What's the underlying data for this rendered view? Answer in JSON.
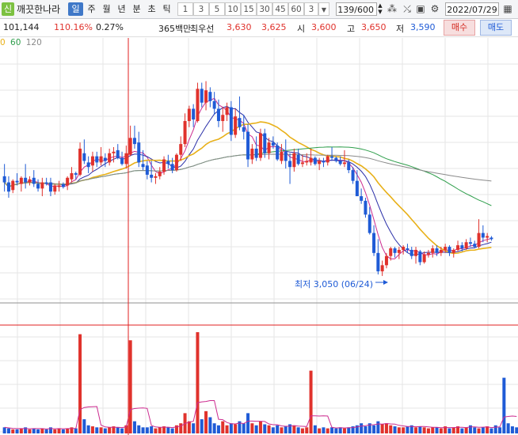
{
  "toolbar": {
    "logo": "신",
    "stock_name": "깨끗한나라",
    "periods": [
      "일",
      "주",
      "월",
      "년",
      "분",
      "초",
      "틱"
    ],
    "active_period": "일",
    "minute_options": [
      "1",
      "3",
      "5",
      "10",
      "15",
      "30",
      "45",
      "60"
    ],
    "selected_minute": "3",
    "count_value": "139/600",
    "date_value": "2022/07/29",
    "icons": [
      "chart-settings-icon",
      "draw-tool-icon",
      "save-icon",
      "gear-icon",
      "calendar-icon"
    ]
  },
  "quote": {
    "volume": "101,144",
    "ratio": "110.16%",
    "change_rate": "0.27%",
    "million_label": "365백만",
    "best_bid_label": "최우선",
    "best_ask": "3,630",
    "best_bid": "3,625",
    "open_label": "시",
    "open": "3,600",
    "high_label": "고",
    "high": "3,650",
    "low_label": "저",
    "low": "3,590",
    "buy_label": "매수",
    "sell_label": "매도"
  },
  "ma_legend": {
    "ma60": "60",
    "ma120": "120"
  },
  "low_marker": "최저 3,050 (06/24)",
  "colors": {
    "up": "#e0322c",
    "down": "#1f5bd6",
    "ma5": "#cc2b8f",
    "ma10": "#2a2fa8",
    "ma20": "#e8b018",
    "ma60": "#2e9e4b",
    "ma120": "#8a8a8a",
    "crosshair": "#e02020"
  },
  "chart_data": {
    "type": "candlestick",
    "y_min": 2900,
    "y_max": 4550,
    "candles": [
      [
        3700,
        3780,
        3600,
        3660
      ],
      [
        3660,
        3700,
        3560,
        3600
      ],
      [
        3610,
        3680,
        3590,
        3670
      ],
      [
        3670,
        3720,
        3640,
        3660
      ],
      [
        3650,
        3700,
        3600,
        3690
      ],
      [
        3690,
        3780,
        3620,
        3660
      ],
      [
        3660,
        3700,
        3640,
        3680
      ],
      [
        3690,
        3740,
        3630,
        3650
      ],
      [
        3650,
        3680,
        3600,
        3620
      ],
      [
        3620,
        3690,
        3570,
        3660
      ],
      [
        3660,
        3690,
        3640,
        3650
      ],
      [
        3660,
        3690,
        3570,
        3600
      ],
      [
        3600,
        3650,
        3580,
        3640
      ],
      [
        3630,
        3670,
        3600,
        3640
      ],
      [
        3650,
        3660,
        3620,
        3630
      ],
      [
        3640,
        3700,
        3610,
        3690
      ],
      [
        3680,
        3760,
        3660,
        3720
      ],
      [
        3720,
        3730,
        3680,
        3710
      ],
      [
        3710,
        3920,
        3700,
        3880
      ],
      [
        3850,
        3940,
        3780,
        3800
      ],
      [
        3790,
        3830,
        3720,
        3760
      ],
      [
        3770,
        3860,
        3730,
        3830
      ],
      [
        3830,
        3860,
        3760,
        3790
      ],
      [
        3790,
        3890,
        3770,
        3830
      ],
      [
        3820,
        3850,
        3760,
        3800
      ],
      [
        3790,
        3880,
        3770,
        3850
      ],
      [
        3850,
        3890,
        3790,
        3860
      ],
      [
        3870,
        3910,
        3810,
        3820
      ],
      [
        3820,
        3860,
        3770,
        3780
      ],
      [
        3780,
        3900,
        3750,
        3850
      ],
      [
        3840,
        4030,
        3830,
        3950
      ],
      [
        3950,
        4030,
        3880,
        3910
      ],
      [
        3920,
        3990,
        3760,
        3790
      ],
      [
        3780,
        3870,
        3740,
        3760
      ],
      [
        3770,
        3800,
        3680,
        3710
      ],
      [
        3710,
        3800,
        3660,
        3690
      ],
      [
        3690,
        3720,
        3650,
        3700
      ],
      [
        3700,
        3760,
        3680,
        3730
      ],
      [
        3730,
        3830,
        3710,
        3810
      ],
      [
        3800,
        3840,
        3750,
        3780
      ],
      [
        3780,
        3820,
        3720,
        3740
      ],
      [
        3740,
        3850,
        3730,
        3840
      ],
      [
        3840,
        3960,
        3800,
        3910
      ],
      [
        3910,
        4110,
        3890,
        4060
      ],
      [
        4060,
        4160,
        4020,
        4140
      ],
      [
        4140,
        4170,
        4020,
        4070
      ],
      [
        4060,
        4310,
        4050,
        4270
      ],
      [
        4270,
        4310,
        4150,
        4180
      ],
      [
        4180,
        4320,
        4130,
        4260
      ],
      [
        4250,
        4280,
        4150,
        4190
      ],
      [
        4190,
        4250,
        4100,
        4140
      ],
      [
        4140,
        4200,
        4020,
        4060
      ],
      [
        4060,
        4150,
        3990,
        4100
      ],
      [
        4100,
        4180,
        4060,
        4150
      ],
      [
        4150,
        4190,
        3930,
        3970
      ],
      [
        3970,
        4140,
        3950,
        4090
      ],
      [
        4080,
        4220,
        4000,
        4020
      ],
      [
        4020,
        4100,
        3940,
        3990
      ],
      [
        3990,
        4040,
        3760,
        3810
      ],
      [
        3810,
        3910,
        3780,
        3880
      ],
      [
        3880,
        3960,
        3800,
        3820
      ],
      [
        3820,
        4010,
        3800,
        3980
      ],
      [
        3980,
        4010,
        3820,
        3850
      ],
      [
        3850,
        3950,
        3810,
        3920
      ],
      [
        3920,
        3960,
        3880,
        3900
      ],
      [
        3900,
        3920,
        3800,
        3810
      ],
      [
        3800,
        3910,
        3780,
        3860
      ],
      [
        3860,
        3940,
        3750,
        3800
      ],
      [
        3800,
        3850,
        3650,
        3760
      ],
      [
        3760,
        3880,
        3730,
        3850
      ],
      [
        3840,
        3880,
        3770,
        3780
      ],
      [
        3780,
        3840,
        3760,
        3790
      ],
      [
        3790,
        3850,
        3770,
        3800
      ],
      [
        3790,
        3880,
        3770,
        3820
      ],
      [
        3820,
        3830,
        3770,
        3780
      ],
      [
        3780,
        3820,
        3740,
        3800
      ],
      [
        3800,
        3820,
        3760,
        3790
      ],
      [
        3790,
        3840,
        3770,
        3830
      ],
      [
        3830,
        3890,
        3800,
        3820
      ],
      [
        3820,
        3830,
        3790,
        3800
      ],
      [
        3800,
        3830,
        3770,
        3780
      ],
      [
        3780,
        3870,
        3760,
        3790
      ],
      [
        3790,
        3810,
        3720,
        3740
      ],
      [
        3740,
        3760,
        3650,
        3670
      ],
      [
        3670,
        3740,
        3600,
        3570
      ],
      [
        3570,
        3620,
        3520,
        3540
      ],
      [
        3540,
        3560,
        3430,
        3450
      ],
      [
        3450,
        3500,
        3320,
        3330
      ],
      [
        3330,
        3380,
        3180,
        3200
      ],
      [
        3200,
        3290,
        3060,
        3080
      ],
      [
        3080,
        3150,
        3050,
        3120
      ],
      [
        3120,
        3200,
        3100,
        3180
      ],
      [
        3180,
        3240,
        3150,
        3230
      ],
      [
        3230,
        3240,
        3170,
        3200
      ],
      [
        3200,
        3240,
        3160,
        3220
      ],
      [
        3220,
        3250,
        3190,
        3240
      ],
      [
        3230,
        3260,
        3200,
        3220
      ],
      [
        3220,
        3240,
        3160,
        3180
      ],
      [
        3180,
        3240,
        3130,
        3220
      ],
      [
        3210,
        3220,
        3120,
        3140
      ],
      [
        3140,
        3210,
        3130,
        3190
      ],
      [
        3190,
        3220,
        3170,
        3200
      ],
      [
        3200,
        3250,
        3170,
        3230
      ],
      [
        3230,
        3250,
        3180,
        3200
      ],
      [
        3200,
        3240,
        3180,
        3220
      ],
      [
        3220,
        3260,
        3200,
        3240
      ],
      [
        3240,
        3250,
        3180,
        3200
      ],
      [
        3200,
        3230,
        3170,
        3220
      ],
      [
        3220,
        3280,
        3210,
        3250
      ],
      [
        3250,
        3270,
        3210,
        3230
      ],
      [
        3230,
        3290,
        3220,
        3270
      ],
      [
        3270,
        3300,
        3240,
        3260
      ],
      [
        3260,
        3280,
        3230,
        3240
      ],
      [
        3240,
        3420,
        3230,
        3330
      ],
      [
        3330,
        3380,
        3270,
        3300
      ],
      [
        3300,
        3330,
        3270,
        3310
      ],
      [
        3300,
        3310,
        3280,
        3290
      ]
    ],
    "ma_periods": [
      5,
      10,
      20,
      60,
      120
    ],
    "volume_max": 100,
    "volumes": [
      6,
      5,
      4,
      4,
      5,
      6,
      4,
      5,
      4,
      5,
      4,
      6,
      4,
      5,
      4,
      5,
      6,
      5,
      98,
      14,
      8,
      7,
      6,
      6,
      5,
      6,
      7,
      6,
      5,
      8,
      92,
      12,
      8,
      6,
      6,
      7,
      5,
      6,
      7,
      6,
      5,
      8,
      10,
      20,
      12,
      10,
      100,
      14,
      22,
      16,
      10,
      8,
      12,
      8,
      10,
      9,
      12,
      10,
      20,
      10,
      8,
      12,
      9,
      8,
      6,
      8,
      6,
      7,
      9,
      8,
      6,
      5,
      6,
      62,
      8,
      5,
      6,
      5,
      6,
      5,
      6,
      5,
      6,
      7,
      8,
      10,
      7,
      10,
      8,
      12,
      9,
      10,
      8,
      7,
      6,
      6,
      7,
      8,
      6,
      7,
      6,
      5,
      6,
      6,
      5,
      7,
      5,
      6,
      7,
      5,
      6,
      8,
      6,
      5,
      6,
      7,
      5,
      8,
      6,
      55,
      10,
      7,
      6
    ]
  }
}
